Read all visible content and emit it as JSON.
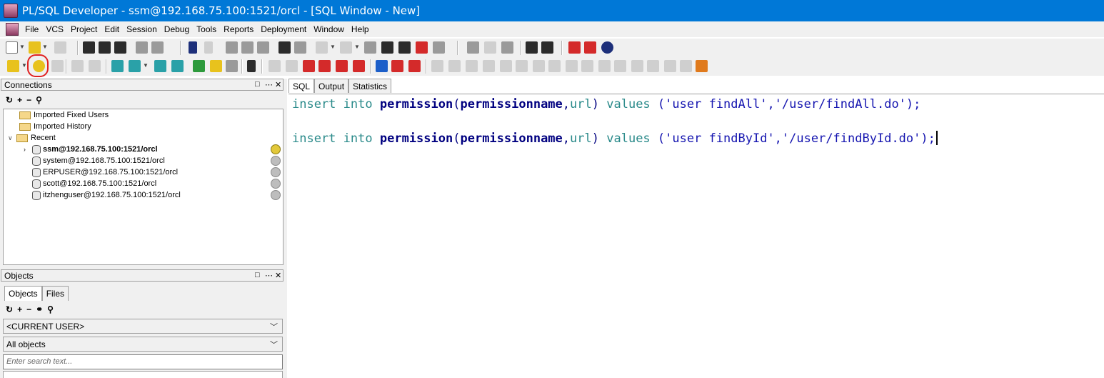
{
  "window": {
    "title": "PL/SQL Developer - ssm@192.168.75.100:1521/orcl - [SQL Window - New]"
  },
  "menu": [
    "File",
    "VCS",
    "Project",
    "Edit",
    "Session",
    "Debug",
    "Tools",
    "Reports",
    "Deployment",
    "Window",
    "Help"
  ],
  "connections_panel": {
    "title": "Connections",
    "controls": [
      "□",
      "⋯",
      "✕"
    ],
    "toolbar_icons": [
      "refresh-icon",
      "add-icon",
      "remove-icon",
      "filter-icon"
    ],
    "folders": [
      "Imported Fixed Users",
      "Imported History",
      "Recent"
    ],
    "items": [
      {
        "label": "ssm@192.168.75.100:1521/orcl",
        "active": true
      },
      {
        "label": "system@192.168.75.100:1521/orcl",
        "active": false
      },
      {
        "label": "ERPUSER@192.168.75.100:1521/orcl",
        "active": false
      },
      {
        "label": "scott@192.168.75.100:1521/orcl",
        "active": false
      },
      {
        "label": "itzhenguser@192.168.75.100:1521/orcl",
        "active": false
      }
    ]
  },
  "objects_panel": {
    "title": "Objects",
    "tabs": [
      "Objects",
      "Files"
    ],
    "owner": "<CURRENT USER>",
    "filter": "All objects",
    "search_placeholder": "Enter search text..."
  },
  "editor": {
    "tabs": [
      "SQL",
      "Output",
      "Statistics"
    ],
    "line1": {
      "kw1": "insert",
      "kw2": "into",
      "table": "permission",
      "p1": "(",
      "c1": "permissionname",
      "comma": ",",
      "c2": "url",
      "p2": ")",
      "kw3": "values",
      "s1": "('user findAll','/user/findAll.do');"
    },
    "line2": {
      "kw1": "insert",
      "kw2": "into",
      "table": "permission",
      "p1": "(",
      "c1": "permissionname",
      "comma": ",",
      "c2": "url",
      "p2": ")",
      "kw3": "values",
      "s1": "('user findById','/user/findById.do');"
    }
  }
}
